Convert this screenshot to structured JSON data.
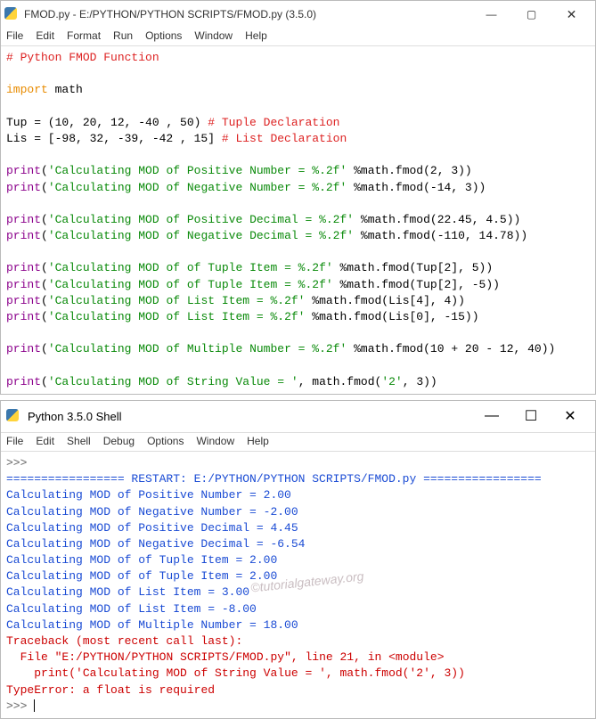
{
  "editor": {
    "title": "FMOD.py - E:/PYTHON/PYTHON SCRIPTS/FMOD.py (3.5.0)",
    "menus": [
      "File",
      "Edit",
      "Format",
      "Run",
      "Options",
      "Window",
      "Help"
    ],
    "win_btns": {
      "min": "—",
      "max": "▢",
      "close": "✕"
    },
    "code": {
      "l1_comment": "# Python FMOD Function",
      "l3a": "import",
      "l3b": " math",
      "l5": "Tup = (10, 20, 12, -40 , 50) ",
      "l5c": "# Tuple Declaration",
      "l6": "Lis = [-98, 32, -39, -42 , 15] ",
      "l6c": "# List Declaration",
      "p1a": "print",
      "p1b": "(",
      "p1s": "'Calculating MOD of Positive Number = %.2f'",
      "p1c": " %math.fmod(2, 3))",
      "p2s": "'Calculating MOD of Negative Number = %.2f'",
      "p2c": " %math.fmod(-14, 3))",
      "p3s": "'Calculating MOD of Positive Decimal = %.2f'",
      "p3c": " %math.fmod(22.45, 4.5))",
      "p4s": "'Calculating MOD of Negative Decimal = %.2f'",
      "p4c": " %math.fmod(-110, 14.78))",
      "p5s": "'Calculating MOD of of Tuple Item = %.2f'",
      "p5c": " %math.fmod(Tup[2], 5))",
      "p6s": "'Calculating MOD of of Tuple Item = %.2f'",
      "p6c": " %math.fmod(Tup[2], -5))",
      "p7s": "'Calculating MOD of List Item = %.2f'",
      "p7c": " %math.fmod(Lis[4], 4))",
      "p8s": "'Calculating MOD of List Item = %.2f'",
      "p8c": " %math.fmod(Lis[0], -15))",
      "p9s": "'Calculating MOD of Multiple Number = %.2f'",
      "p9c": " %math.fmod(10 + 20 - 12, 40))",
      "p10s": "'Calculating MOD of String Value = '",
      "p10c": ", math.fmod(",
      "p10s2": "'2'",
      "p10d": ", 3))"
    }
  },
  "shell": {
    "title": "Python 3.5.0 Shell",
    "menus": [
      "File",
      "Edit",
      "Shell",
      "Debug",
      "Options",
      "Window",
      "Help"
    ],
    "win_btns": {
      "min": "—",
      "max": "☐",
      "close": "✕"
    },
    "prompt": ">>> ",
    "restart": "================= RESTART: E:/PYTHON/PYTHON SCRIPTS/FMOD.py =================",
    "out": [
      "Calculating MOD of Positive Number = 2.00",
      "Calculating MOD of Negative Number = -2.00",
      "Calculating MOD of Positive Decimal = 4.45",
      "Calculating MOD of Negative Decimal = -6.54",
      "Calculating MOD of of Tuple Item = 2.00",
      "Calculating MOD of of Tuple Item = 2.00",
      "Calculating MOD of List Item = 3.00",
      "Calculating MOD of List Item = -8.00",
      "Calculating MOD of Multiple Number = 18.00"
    ],
    "tb1": "Traceback (most recent call last):",
    "tb2a": "  File ",
    "tb2b": "\"E:/PYTHON/PYTHON SCRIPTS/FMOD.py\"",
    "tb2c": ", line 21, in ",
    "tb2d": "<module>",
    "tb3": "    print('Calculating MOD of String Value = ', math.fmod('2', 3))",
    "tb4a": "TypeError",
    "tb4b": ": a float is required",
    "watermark": "©tutorialgateway.org"
  }
}
